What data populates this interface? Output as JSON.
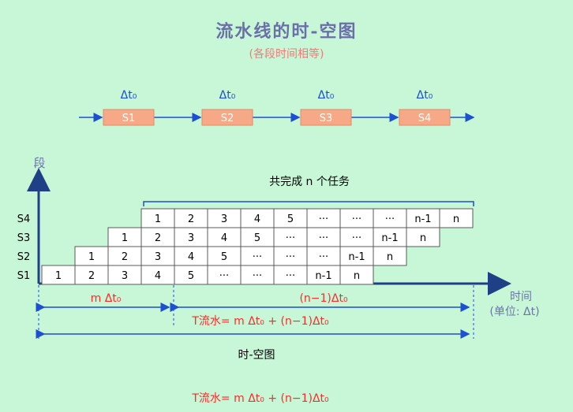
{
  "header": {
    "title": "流水线的时-空图",
    "subtitle": "(各段时间相等)"
  },
  "pipeline": {
    "stages": [
      "S1",
      "S2",
      "S3",
      "S4"
    ],
    "delta_label": "Δt₀"
  },
  "diagram": {
    "y_axis_label": "段",
    "x_axis_label": "时间",
    "x_axis_unit": "(单位: Δt)",
    "top_brace_label": "共完成 n 个任务",
    "rows": [
      "S4",
      "S3",
      "S2",
      "S1"
    ],
    "grid": [
      [
        "",
        "",
        "",
        "1",
        "2",
        "3",
        "4",
        "5",
        "···",
        "···",
        "···",
        "n-1",
        "n"
      ],
      [
        "",
        "",
        "1",
        "2",
        "3",
        "4",
        "5",
        "···",
        "···",
        "···",
        "n-1",
        "n",
        ""
      ],
      [
        "",
        "1",
        "2",
        "3",
        "4",
        "5",
        "···",
        "···",
        "···",
        "n-1",
        "n",
        "",
        ""
      ],
      [
        "1",
        "2",
        "3",
        "4",
        "5",
        "···",
        "···",
        "···",
        "n-1",
        "n",
        "",
        "",
        ""
      ]
    ],
    "left_span_label": "m Δt₀",
    "right_span_label": "(n−1)Δt₀",
    "formula_mid": "T流水= m Δt₀ + (n−1)Δt₀",
    "caption": "时-空图",
    "formula_bottom": "T流水= m Δt₀ + (n−1)Δt₀"
  },
  "colors": {
    "background": "#c8f7d8",
    "stage_fill": "#f7a987",
    "arrow_blue": "#1d4fd1",
    "axis_blue": "#1f3f86",
    "red_text": "#ff2a2a"
  }
}
